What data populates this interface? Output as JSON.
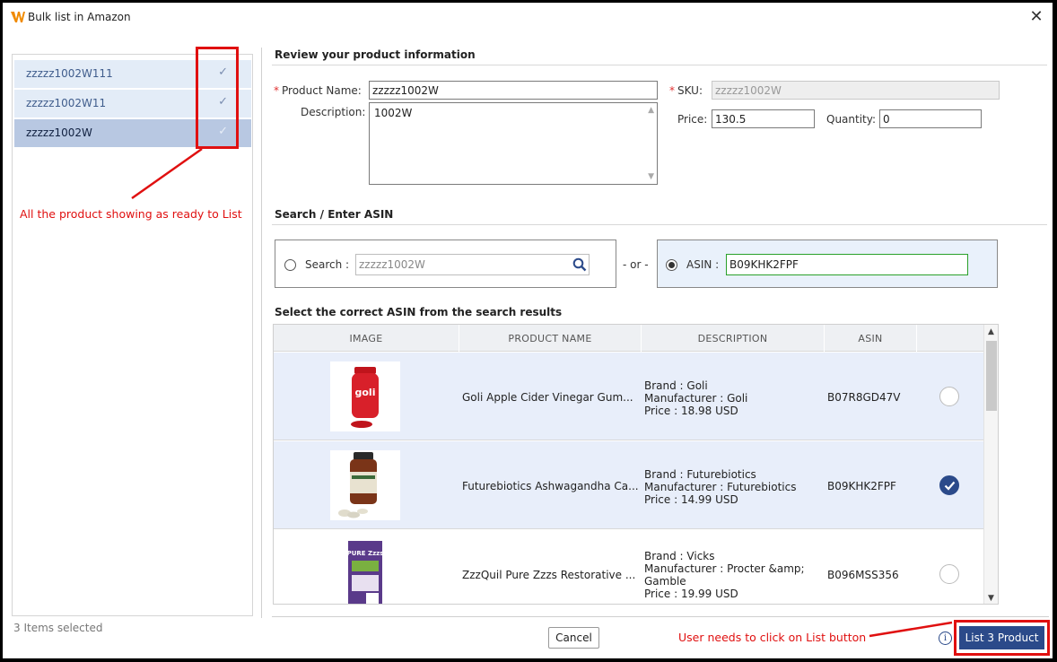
{
  "window": {
    "title": "Bulk list in Amazon",
    "close_glyph": "✕"
  },
  "left_panel": {
    "items": [
      {
        "label": "zzzzz1002W111",
        "check": "✓"
      },
      {
        "label": "zzzzz1002W11",
        "check": "✓"
      },
      {
        "label": "zzzzz1002W",
        "check": "✓"
      }
    ],
    "footer": "3 Items selected"
  },
  "annotations": {
    "left_note": "All the product showing as ready to List",
    "bottom_note": "User needs to click on List button",
    "color": "#e01010"
  },
  "review": {
    "title": "Review your product information",
    "product_name_label": "Product Name:",
    "product_name_value": "zzzzz1002W",
    "description_label": "Description:",
    "description_value": "1002W",
    "sku_label": "SKU:",
    "sku_value": "zzzzz1002W",
    "price_label": "Price:",
    "price_value": "130.5",
    "quantity_label": "Quantity:",
    "quantity_value": "0",
    "required_mark": "*"
  },
  "asin_section": {
    "title": "Search / Enter ASIN",
    "search_label": "Search :",
    "search_value": "zzzzz1002W",
    "or_text": "- or -",
    "asin_label": "ASIN :",
    "asin_value": "B09KHK2FPF"
  },
  "results": {
    "title": "Select the correct ASIN from the search results",
    "headers": [
      "IMAGE",
      "PRODUCT NAME",
      "DESCRIPTION",
      "ASIN"
    ],
    "rows": [
      {
        "name": "Goli Apple Cider Vinegar Gum...",
        "desc": [
          "Brand : Goli",
          "Manufacturer : Goli",
          "Price : 18.98 USD"
        ],
        "asin": "B07R8GD47V",
        "thumb_text": "goli"
      },
      {
        "name": "Futurebiotics Ashwagandha Ca...",
        "desc": [
          "Brand : Futurebiotics",
          "Manufacturer : Futurebiotics",
          "Price : 14.99 USD"
        ],
        "asin": "B09KHK2FPF",
        "thumb_text": ""
      },
      {
        "name": "ZzzQuil Pure Zzzs Restorative ...",
        "desc": [
          "Brand : Vicks",
          "Manufacturer : Procter &amp;",
          "Gamble",
          "Price : 19.99 USD"
        ],
        "asin": "B096MSS356",
        "thumb_text": "PURE Zzzs"
      }
    ],
    "scroll_up": "▲",
    "scroll_down": "▼"
  },
  "footer": {
    "cancel_label": "Cancel",
    "info_glyph": "i",
    "list_label": "List 3 Product"
  },
  "colors": {
    "accent": "#2b4a8a",
    "selected_row": "#e8eefa",
    "left_item": "#e3ecf7",
    "left_item_selected": "#b8c8e2"
  }
}
